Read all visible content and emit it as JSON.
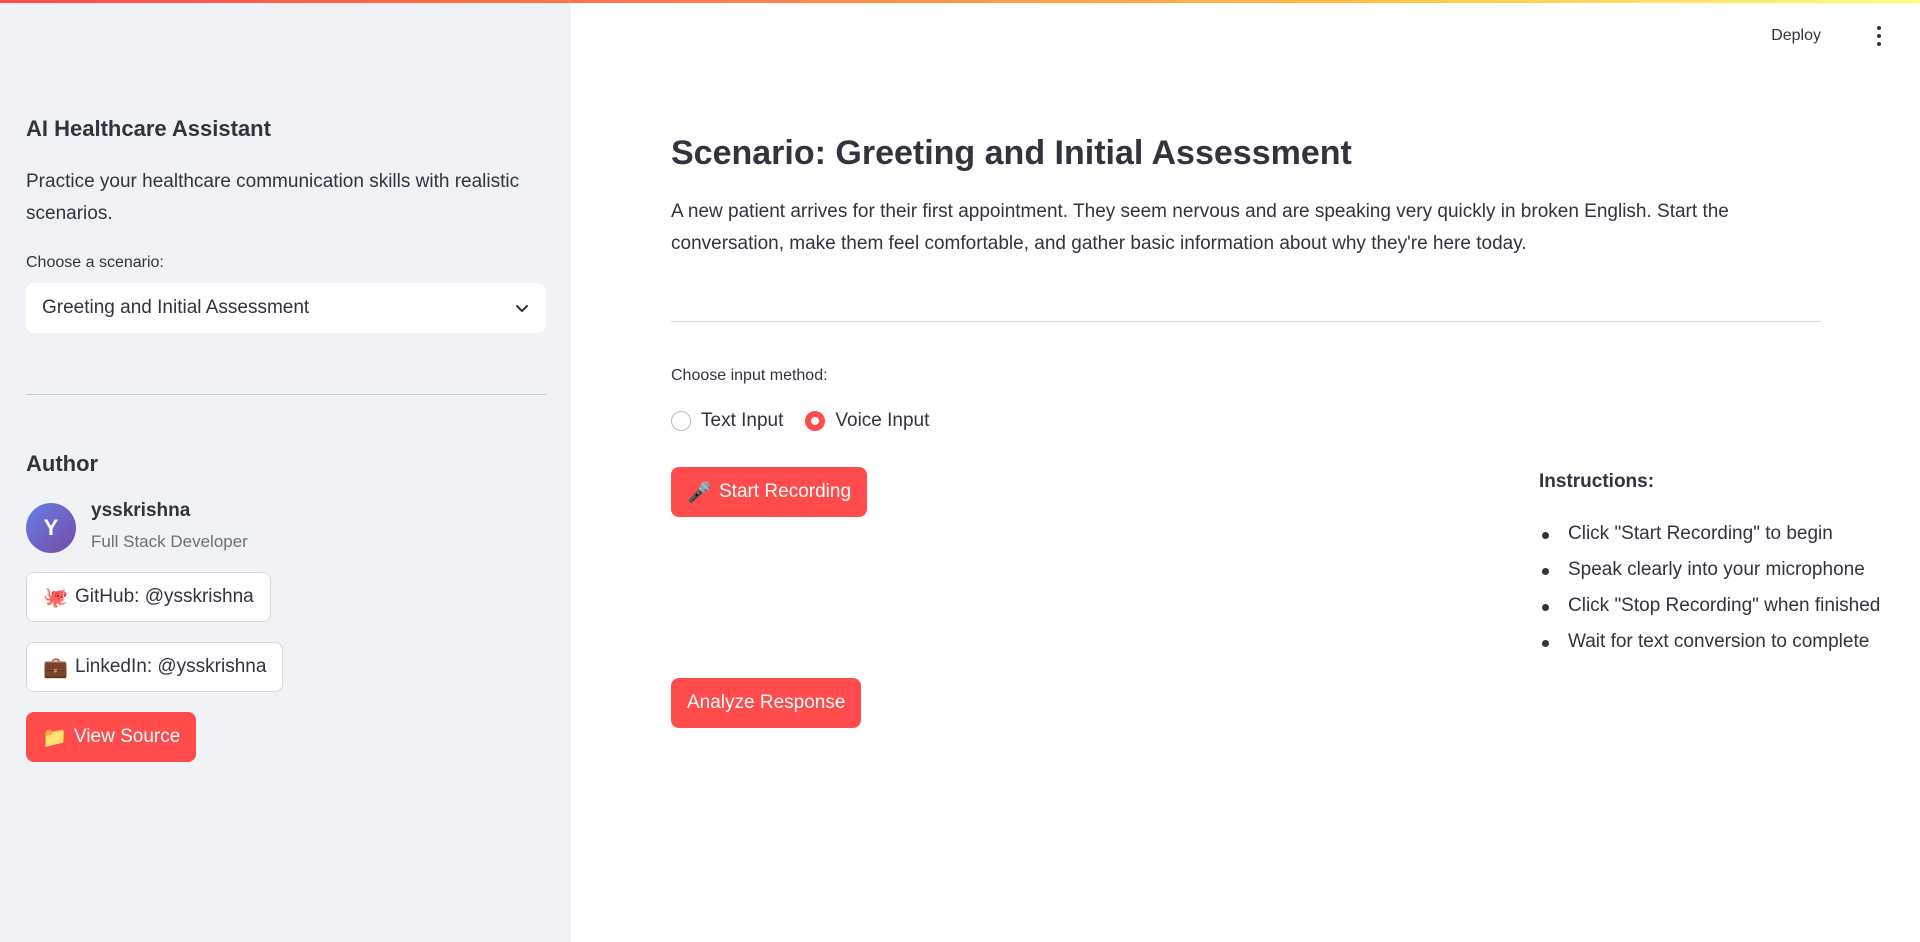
{
  "header": {
    "deploy_label": "Deploy"
  },
  "sidebar": {
    "title": "AI Healthcare Assistant",
    "description": "Practice your healthcare communication skills with realistic scenarios.",
    "scenario_label": "Choose a scenario:",
    "scenario_selected": "Greeting and Initial Assessment",
    "author_heading": "Author",
    "avatar_initial": "Y",
    "author_name": "ysskrishna",
    "author_role": "Full Stack Developer",
    "github_label": "GitHub: @ysskrishna",
    "github_emoji": "🐙",
    "linkedin_label": "LinkedIn: @ysskrishna",
    "linkedin_emoji": "💼",
    "view_source_label": "View Source",
    "view_source_emoji": "📁"
  },
  "main": {
    "scenario_title": "Scenario: Greeting and Initial Assessment",
    "scenario_description": "A new patient arrives for their first appointment. They seem nervous and are speaking very quickly in broken English. Start the conversation, make them feel comfortable, and gather basic information about why they're here today.",
    "input_method_label": "Choose input method:",
    "input_options": [
      "Text Input",
      "Voice Input"
    ],
    "input_selected": "Voice Input",
    "record_button_label": "Start Recording",
    "record_emoji": "🎤",
    "instructions_title": "Instructions:",
    "instructions": [
      "Click \"Start Recording\" to begin",
      "Speak clearly into your microphone",
      "Click \"Stop Recording\" when finished",
      "Wait for text conversion to complete"
    ],
    "analyze_button_label": "Analyze Response"
  },
  "colors": {
    "primary": "#ff4b4b",
    "sidebar_bg": "#f0f2f6",
    "text": "#31333f"
  }
}
